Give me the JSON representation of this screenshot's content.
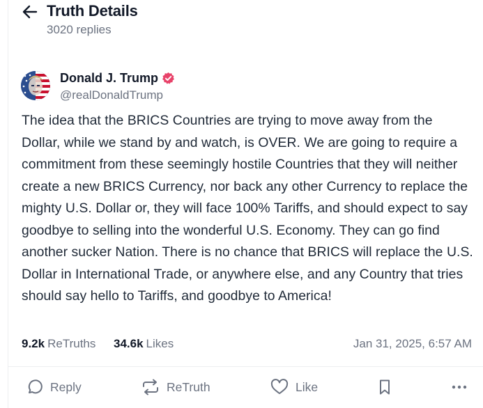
{
  "header": {
    "title": "Truth Details",
    "reply_count": "3020 replies"
  },
  "post": {
    "author_name": "Donald J. Trump",
    "handle": "@realDonaldTrump",
    "text": "The idea that the BRICS Countries are trying to move away from the Dollar, while we stand by and watch, is OVER. We are going to require a commitment from these seemingly hostile Countries that they will neither create a new BRICS Currency, nor back any other Currency to replace the mighty U.S. Dollar or, they will face 100% Tariffs, and should expect to say goodbye to selling into the wonderful U.S. Economy. They can go find another sucker Nation. There is no chance that BRICS will replace the U.S. Dollar in International Trade, or anywhere else, and any Country that tries should say hello to Tariffs, and goodbye to America!",
    "retruths_count": "9.2k",
    "retruths_label": "ReTruths",
    "likes_count": "34.6k",
    "likes_label": "Likes",
    "timestamp": "Jan 31, 2025, 6:57 AM"
  },
  "actions": {
    "reply_label": "Reply",
    "retruth_label": "ReTruth",
    "like_label": "Like"
  },
  "icons": {
    "back": "arrow-left-icon",
    "verified": "verified-badge-icon",
    "reply": "speech-bubble-icon",
    "retruth": "repost-arrows-icon",
    "like": "heart-icon",
    "bookmark": "bookmark-icon",
    "more": "ellipsis-icon"
  },
  "colors": {
    "verified_badge": "#e8436a",
    "secondary_text": "#6b7280",
    "primary_text": "#111827"
  }
}
